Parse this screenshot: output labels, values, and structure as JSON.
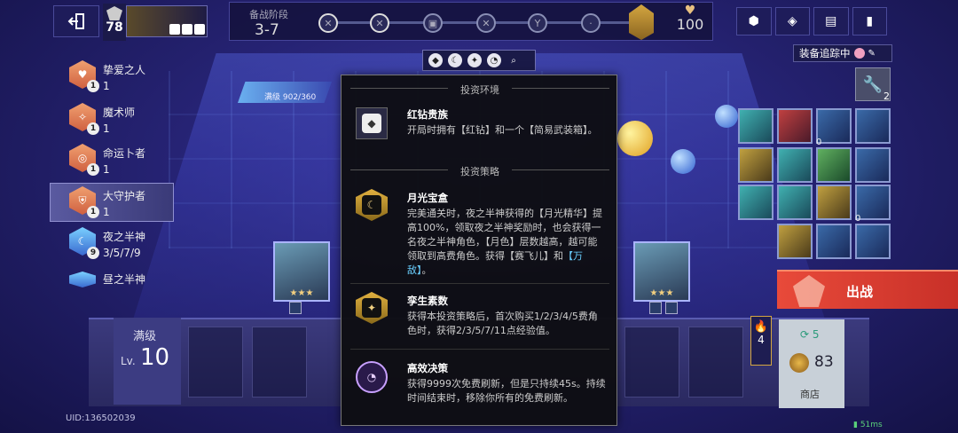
{
  "topbar": {
    "player_level": "78",
    "stage_label": "备战阶段",
    "stage_value": "3-7",
    "hp_value": "100"
  },
  "filter": {
    "search_icon": "search-icon"
  },
  "track_equip": {
    "label": "装备追踪中"
  },
  "traits": [
    {
      "name": "挚爱之人",
      "badge": "1",
      "count": "1"
    },
    {
      "name": "魔术师",
      "badge": "1",
      "count": "1"
    },
    {
      "name": "命运卜者",
      "badge": "1",
      "count": "1"
    },
    {
      "name": "大守护者",
      "badge": "1",
      "count": "1"
    },
    {
      "name": "夜之半神",
      "badge": "9",
      "count": "3/5/7/9"
    },
    {
      "name": "昼之半神",
      "badge": "",
      "count": ""
    }
  ],
  "moon_token": {
    "label": "满级 902/360"
  },
  "items": {
    "wrench_count": "2",
    "qty_a": "0",
    "qty_b": "0",
    "qty_c": "0"
  },
  "battle": {
    "label": "出战"
  },
  "level_panel": {
    "top": "满级",
    "prefix": "Lv.",
    "num": "10"
  },
  "uid": "UID:136502039",
  "flame": {
    "value": "4"
  },
  "shop": {
    "refresh": "5",
    "gold": "83",
    "label": "商店"
  },
  "ping": "51ms",
  "popup": {
    "env_head": "投资环境",
    "env": {
      "title": "红钻贵族",
      "desc": "开局时拥有【红钻】和一个【简易武装箱】。"
    },
    "strat_head": "投资策略",
    "strategies": [
      {
        "title": "月光宝盒",
        "desc_a": "完美通关时，夜之半神获得的【月光精华】提高100%，领取夜之半神奖励时，也会获得一名夜之半神角色，【月色】层数越高，越可能领取到高费角色。获得【赛飞儿】和",
        "desc_b": "【万敌】",
        "desc_c": "。"
      },
      {
        "title": "孪生素数",
        "desc": "获得本投资策略后，首次购买1/2/3/4/5费角色时，获得2/3/5/7/11点经验值。"
      },
      {
        "title": "高效决策",
        "desc": "获得9999次免费刷新，但是只持续45s。持续时间结束时，移除你所有的免费刷新。"
      }
    ]
  }
}
